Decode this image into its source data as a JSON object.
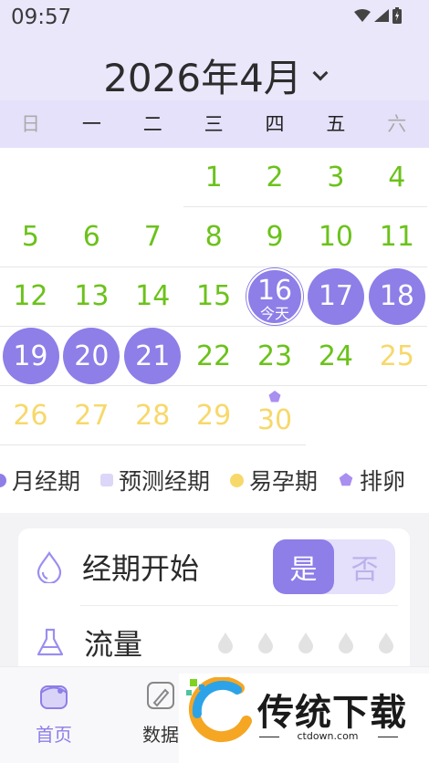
{
  "status_bar": {
    "time": "09:57"
  },
  "header": {
    "month_title": "2026年4月"
  },
  "weekdays": [
    "日",
    "一",
    "二",
    "三",
    "四",
    "五",
    "六"
  ],
  "calendar": {
    "rows": [
      [
        null,
        null,
        null,
        {
          "d": "1",
          "s": "green"
        },
        {
          "d": "2",
          "s": "green"
        },
        {
          "d": "3",
          "s": "green"
        },
        {
          "d": "4",
          "s": "green"
        }
      ],
      [
        {
          "d": "5",
          "s": "green"
        },
        {
          "d": "6",
          "s": "green"
        },
        {
          "d": "7",
          "s": "green"
        },
        {
          "d": "8",
          "s": "green"
        },
        {
          "d": "9",
          "s": "green"
        },
        {
          "d": "10",
          "s": "green"
        },
        {
          "d": "11",
          "s": "green"
        }
      ],
      [
        {
          "d": "12",
          "s": "green"
        },
        {
          "d": "13",
          "s": "green"
        },
        {
          "d": "14",
          "s": "green"
        },
        {
          "d": "15",
          "s": "green"
        },
        {
          "d": "16",
          "s": "period",
          "today": true
        },
        {
          "d": "17",
          "s": "period"
        },
        {
          "d": "18",
          "s": "period"
        }
      ],
      [
        {
          "d": "19",
          "s": "period"
        },
        {
          "d": "20",
          "s": "period"
        },
        {
          "d": "21",
          "s": "period"
        },
        {
          "d": "22",
          "s": "green"
        },
        {
          "d": "23",
          "s": "green"
        },
        {
          "d": "24",
          "s": "green"
        },
        {
          "d": "25",
          "s": "yellow"
        }
      ],
      [
        {
          "d": "26",
          "s": "yellow"
        },
        {
          "d": "27",
          "s": "yellow"
        },
        {
          "d": "28",
          "s": "yellow"
        },
        {
          "d": "29",
          "s": "yellow"
        },
        {
          "d": "30",
          "s": "yellow",
          "ovulation": true
        },
        null,
        null
      ]
    ],
    "today_label": "今天"
  },
  "legend": [
    {
      "label": "月经期",
      "shape": "dot",
      "color": "#8d7ee8"
    },
    {
      "label": "预测经期",
      "shape": "sq",
      "color": "#dcd6f8"
    },
    {
      "label": "易孕期",
      "shape": "dot",
      "color": "#f7d86a"
    },
    {
      "label": "排卵",
      "shape": "flower",
      "color": "#a98ff0"
    }
  ],
  "card": {
    "period_start_label": "经期开始",
    "toggle_yes": "是",
    "toggle_no": "否",
    "flow_label": "流量"
  },
  "bottom_nav": {
    "home_label": "首页",
    "data_label": "数据"
  },
  "watermark": {
    "brand": "传统下载",
    "url": "ctdown.com"
  },
  "colors": {
    "accent": "#8d7ee8",
    "header_bg": "#ebe7fb",
    "green_day": "#6bc21a",
    "fertile_day": "#f7d86a"
  }
}
